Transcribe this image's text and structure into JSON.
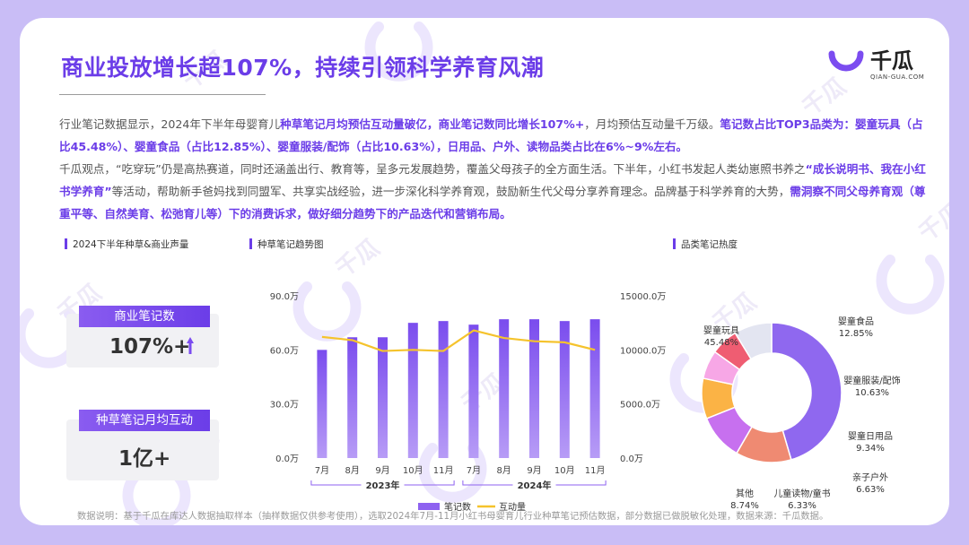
{
  "brand": {
    "name_cn": "千瓜",
    "name_en": "QIAN-GUA.COM",
    "accent": "#6b3de8",
    "line": "#f5c32c"
  },
  "title": "商业投放增长超107%，持续引领科学养育风潮",
  "paragraph": {
    "p1_a": "行业笔记数据显示，2024年下半年母婴育儿",
    "p1_b": "种草笔记月均预估互动量破亿，商业笔记数同比增长107%+",
    "p1_c": "，月均预估互动量千万级。",
    "p1_d": "笔记数占比TOP3品类为：婴童玩具（占比45.48%）、婴童食品（占比12.85%）、婴童服装/配饰（占比10.63%），日用品、户外、读物品类占比在6%~9%左右。",
    "p2_a": "千瓜观点，“吃穿玩”仍是高热赛道，同时还涵盖出行、教育等，呈多元发展趋势，覆盖父母孩子的全方面生活。下半年，小红书发起人类幼崽照书养之",
    "p2_b": "“成长说明书、我在小红书学养育”",
    "p2_c": "等活动，帮助新手爸妈找到同盟军、共享实战经验，进一步深化科学养育观，鼓励新生代父母分享养育理念。品牌基于科学养育的大势，",
    "p2_d": "需洞察不同父母养育观（尊重平等、自然美育、松弛育儿等）下的消费诉求，做好细分趋势下的产品迭代和营销布局。"
  },
  "kpi": {
    "section_title": "2024下半年种草&商业声量",
    "commercial": {
      "label": "商业笔记数",
      "value": "107%+"
    },
    "interaction": {
      "label": "种草笔记月均互动",
      "value": "1亿+"
    }
  },
  "footer": "数据说明：基于千瓜在库达人数据抽取样本（抽样数据仅供参考使用），选取2024年7月-11月小红书母婴育儿行业种草笔记预估数据，部分数据已做脱敏化处理，数据来源：千瓜数据。",
  "chart_data": [
    {
      "type": "bar",
      "title": "种草笔记趋势图",
      "categories": [
        "7月",
        "8月",
        "9月",
        "10月",
        "11月",
        "7月",
        "8月",
        "9月",
        "10月",
        "11月"
      ],
      "groups": [
        {
          "label": "2023年",
          "from": 0,
          "to": 4
        },
        {
          "label": "2024年",
          "from": 5,
          "to": 9
        }
      ],
      "series": [
        {
          "name": "笔记数",
          "kind": "bar",
          "axis": "left",
          "color": "#8e62f0",
          "values": [
            60,
            67,
            67,
            75,
            76,
            74,
            77,
            77,
            76,
            77
          ]
        },
        {
          "name": "互动量",
          "kind": "line",
          "axis": "right",
          "color": "#f5c32c",
          "values": [
            11200,
            10900,
            9900,
            10000,
            9900,
            11800,
            11100,
            10800,
            10700,
            10000
          ]
        }
      ],
      "yleft": {
        "ticks": [
          "0.0万",
          "30.0万",
          "60.0万",
          "90.0万"
        ],
        "tick_values": [
          0,
          30,
          60,
          90
        ],
        "ylim": [
          0,
          90
        ]
      },
      "yright": {
        "ticks": [
          "0.0万",
          "5000.0万",
          "10000.0万",
          "15000.0万"
        ],
        "tick_values": [
          0,
          5000,
          10000,
          15000
        ],
        "ylim": [
          0,
          15000
        ]
      },
      "legend": "bottom"
    },
    {
      "type": "pie",
      "title": "品类笔记热度",
      "donut": true,
      "slices": [
        {
          "label": "婴童玩具",
          "pct": "45.48%",
          "value": 45.48,
          "color": "#8f68ef"
        },
        {
          "label": "婴童食品",
          "pct": "12.85%",
          "value": 12.85,
          "color": "#ef8a72"
        },
        {
          "label": "婴童服装/配饰",
          "pct": "10.63%",
          "value": 10.63,
          "color": "#c770ef"
        },
        {
          "label": "婴童日用品",
          "pct": "9.34%",
          "value": 9.34,
          "color": "#fbb345"
        },
        {
          "label": "亲子户外",
          "pct": "6.63%",
          "value": 6.63,
          "color": "#f7a7e6"
        },
        {
          "label": "儿童读物/童书",
          "pct": "6.33%",
          "value": 6.33,
          "color": "#ef5d72"
        },
        {
          "label": "其他",
          "pct": "8.74%",
          "value": 8.74,
          "color": "#e3e5f1"
        }
      ]
    }
  ]
}
